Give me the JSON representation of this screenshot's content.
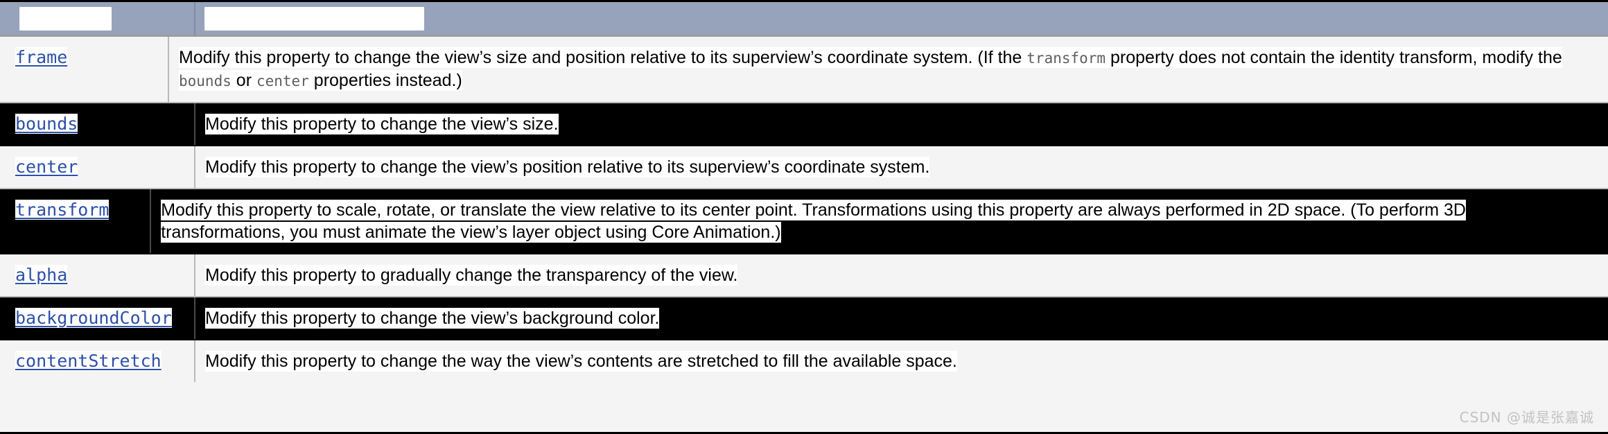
{
  "table": {
    "header": {
      "col_property_label": "",
      "col_description_label": "",
      "col_property_redacted": true,
      "col_description_redacted": true
    },
    "colors": {
      "header_bg": "#96a3ba",
      "row_bg": "#f4f4f5",
      "row_inverted_bg": "#000000",
      "link": "#2c4fa8",
      "code": "#5e5e5e",
      "selection_highlight": "#ffffff",
      "border": "#b9b9b6",
      "outer_border": "#000000",
      "watermark": "#c2c2c2"
    },
    "rows": [
      {
        "property": "frame",
        "inverted": false,
        "description_parts": [
          {
            "type": "text",
            "value": "Modify this property to change the view’s size and position relative to its superview’s coordinate system. (If the "
          },
          {
            "type": "code",
            "value": "transform"
          },
          {
            "type": "text",
            "value": " property does not contain the identity transform, modify the "
          },
          {
            "type": "code",
            "value": "bounds"
          },
          {
            "type": "text",
            "value": " or "
          },
          {
            "type": "code",
            "value": "center"
          },
          {
            "type": "text",
            "value": " properties instead.)"
          }
        ],
        "description_plain": "Modify this property to change the view’s size and position relative to its superview’s coordinate system. (If the transform property does not contain the identity transform, modify the bounds or center properties instead.)"
      },
      {
        "property": "bounds",
        "inverted": true,
        "description_parts": [
          {
            "type": "text",
            "value": "Modify this property to change the view’s size."
          }
        ],
        "description_plain": "Modify this property to change the view’s size."
      },
      {
        "property": "center",
        "inverted": false,
        "description_parts": [
          {
            "type": "text",
            "value": "Modify this property to change the view’s position relative to its superview’s coordinate system."
          }
        ],
        "description_plain": "Modify this property to change the view’s position relative to its superview’s coordinate system."
      },
      {
        "property": "transform",
        "inverted": true,
        "description_parts": [
          {
            "type": "text",
            "value": "Modify this property to scale, rotate, or translate the view relative to its center point. Transformations using this property are always performed in 2D space. (To perform 3D transformations, you must animate the view’s layer object using Core Animation.)"
          }
        ],
        "description_plain": "Modify this property to scale, rotate, or translate the view relative to its center point. Transformations using this property are always performed in 2D space. (To perform 3D transformations, you must animate the view’s layer object using Core Animation.)"
      },
      {
        "property": "alpha",
        "inverted": false,
        "description_parts": [
          {
            "type": "text",
            "value": "Modify this property to gradually change the transparency of the view."
          }
        ],
        "description_plain": "Modify this property to gradually change the transparency of the view."
      },
      {
        "property": "backgroundColor",
        "inverted": true,
        "description_parts": [
          {
            "type": "text",
            "value": "Modify this property to change the view’s background color."
          }
        ],
        "description_plain": "Modify this property to change the view’s background color."
      },
      {
        "property": "contentStretch",
        "inverted": false,
        "description_parts": [
          {
            "type": "text",
            "value": "Modify this property to change the way the view’s contents are stretched to fill the available space."
          }
        ],
        "description_plain": "Modify this property to change the way the view’s contents are stretched to fill the available space."
      }
    ]
  },
  "watermark": {
    "text": "CSDN @诚是张嘉诚"
  }
}
